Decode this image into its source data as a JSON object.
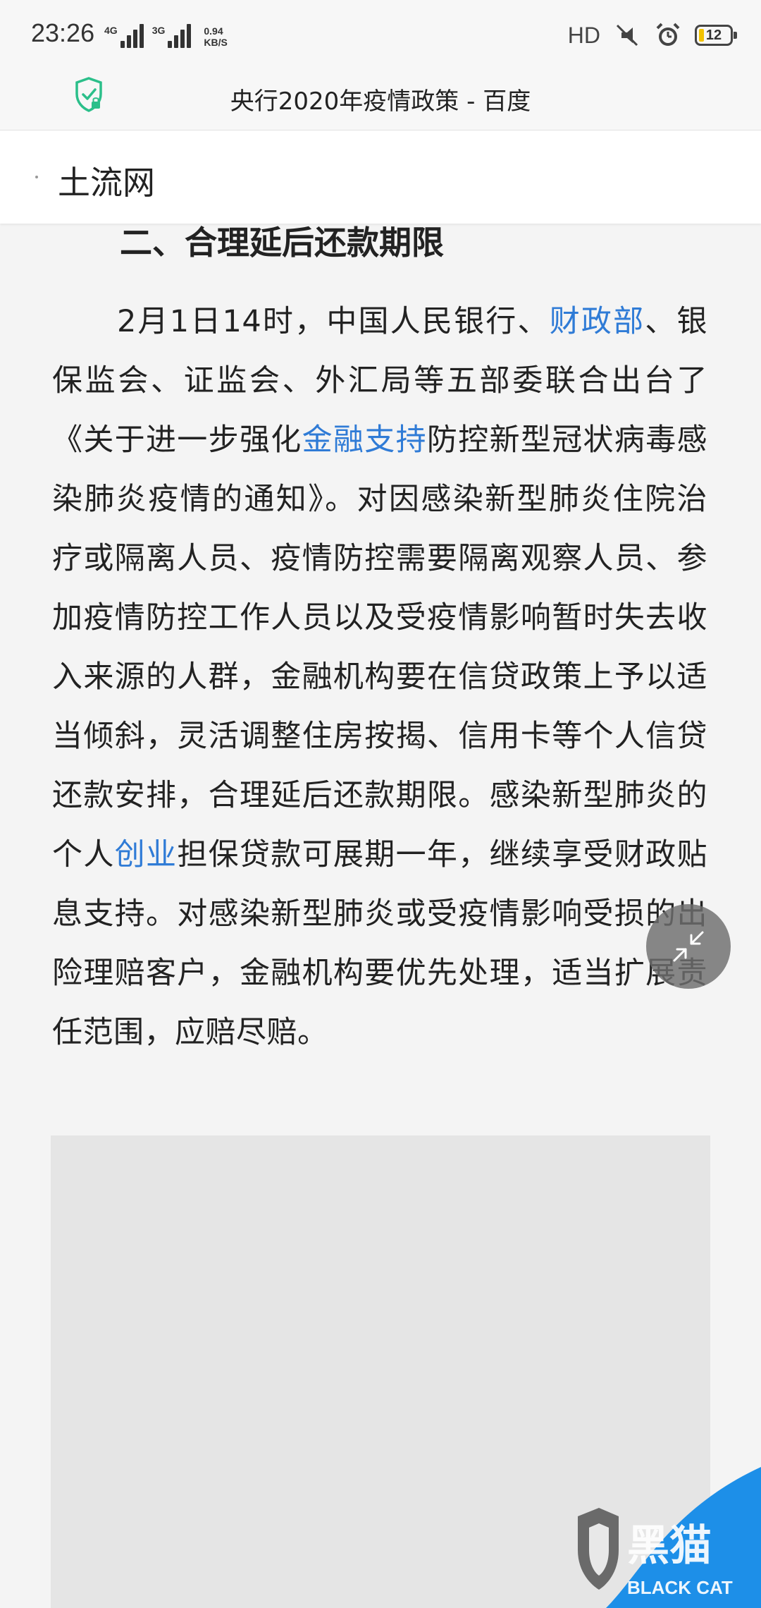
{
  "status_bar": {
    "time": "23:26",
    "network_1": "4G",
    "network_2": "3G",
    "speed_value": "0.94",
    "speed_unit": "KB/S",
    "hd_label": "HD",
    "battery": "12"
  },
  "browser": {
    "title": "央行2020年疫情政策 - 百度"
  },
  "site": {
    "name": "土流网"
  },
  "article": {
    "heading": "二、合理延后还款期限",
    "segments": [
      {
        "text": "2月1日14时，中国人民银行、",
        "link": false
      },
      {
        "text": "财政部",
        "link": true
      },
      {
        "text": "、银保监会、证监会、外汇局等五部委联合出台了《关于进一步强化",
        "link": false
      },
      {
        "text": "金融支持",
        "link": true
      },
      {
        "text": "防控新型冠状病毒感染肺炎疫情的通知》。对因感染新型肺炎住院治疗或隔离人员、疫情防控需要隔离观察人员、参加疫情防控工作人员以及受疫情影响暂时失去收入来源的人群，金融机构要在信贷政策上予以适当倾斜，灵活调整住房按揭、信用卡等个人信贷还款安排，合理延后还款期限。感染新型肺炎的个人",
        "link": false
      },
      {
        "text": "创业",
        "link": true
      },
      {
        "text": "担保贷款可展期一年，继续享受财政贴息支持。对感染新型肺炎或受疫情影响受损的出险理赔客户，金融机构要优先处理，适当扩展责任范围，应赔尽赔。",
        "link": false
      }
    ]
  },
  "watermark": {
    "cn": "黑猫",
    "en": "BLACK CAT"
  },
  "colors": {
    "link": "#2f7bd6",
    "shield": "#2bbf8a",
    "battery": "#f3c300",
    "watermark_blue": "#1d8fe8"
  }
}
